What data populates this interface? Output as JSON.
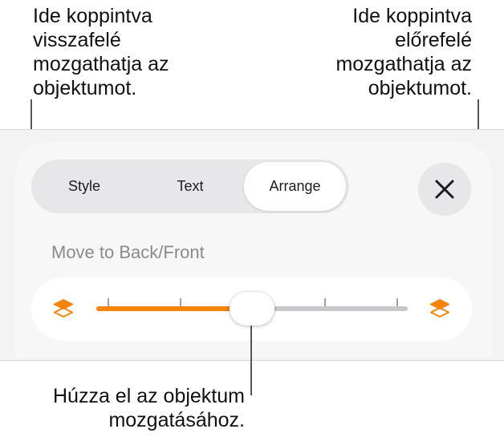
{
  "callouts": {
    "back": "Ide koppintva\nvisszafelé\nmozgathatja az\nobjektumot.",
    "front": "Ide koppintva\nelőrefelé\nmozgathatja az\nobjektumot.",
    "drag": "Húzza el az objektum\nmozgatásához."
  },
  "tabs": [
    {
      "label": "Style",
      "selected": false
    },
    {
      "label": "Text",
      "selected": false
    },
    {
      "label": "Arrange",
      "selected": true
    }
  ],
  "close_icon": "close-icon",
  "arrange": {
    "section_label": "Move to Back/Front",
    "slider": {
      "value": 0.5,
      "ticks": 5
    },
    "back_icon": "layers-back-icon",
    "front_icon": "layers-front-icon"
  },
  "colors": {
    "accent": "#f5840c",
    "track": "#c7c7cc"
  }
}
